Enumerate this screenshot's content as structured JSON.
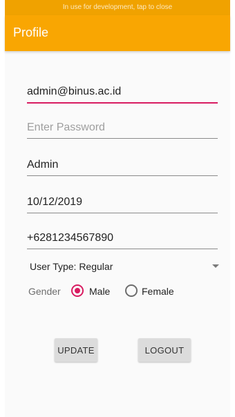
{
  "status_bar": {
    "text": "In use for development, tap to close"
  },
  "app_bar": {
    "title": "Profile"
  },
  "form": {
    "email": {
      "value": "admin@binus.ac.id"
    },
    "password": {
      "placeholder": "Enter Password"
    },
    "name": {
      "value": "Admin"
    },
    "dob": {
      "value": "10/12/2019"
    },
    "phone": {
      "value": "+6281234567890"
    },
    "user_type": {
      "selected": "User Type: Regular"
    },
    "gender": {
      "label": "Gender",
      "options": [
        {
          "label": "Male",
          "checked": true
        },
        {
          "label": "Female",
          "checked": false
        }
      ]
    }
  },
  "buttons": {
    "update": "UPDATE",
    "logout": "LOGOUT"
  },
  "colors": {
    "app_bar": "#f9a602",
    "status_bar": "#f0a200",
    "accent": "#d81b60",
    "button_bg": "#dcdcdc"
  }
}
